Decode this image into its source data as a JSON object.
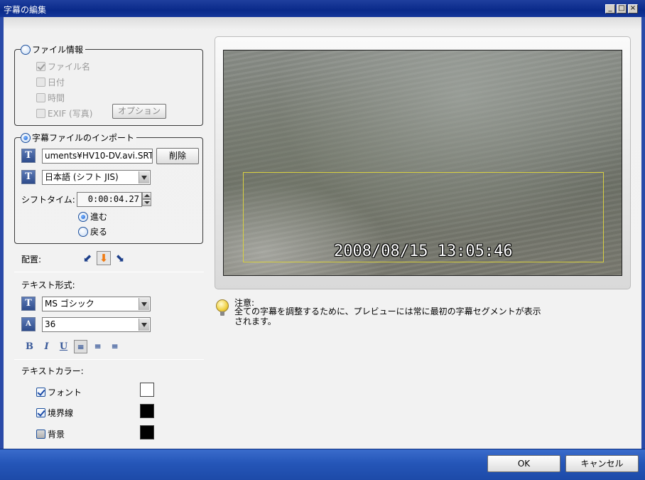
{
  "window": {
    "title": "字幕の編集"
  },
  "file_info": {
    "legend": "ファイル情報",
    "filename_label": "ファイル名",
    "date_label": "日付",
    "time_label": "時間",
    "exif_label": "EXIF (写真)",
    "option_button": "オプション"
  },
  "import": {
    "legend": "字幕ファイルのインポート",
    "path_value": "uments¥HV10-DV.avi.SRT",
    "delete_button": "削除",
    "encoding_value": "日本語 (シフト JIS)",
    "shift_time_label": "シフトタイム:",
    "shift_time_value": "0:00:04.27",
    "forward_label": "進む",
    "back_label": "戻る"
  },
  "placement": {
    "label": "配置:"
  },
  "text_format": {
    "label": "テキスト形式:",
    "font_value": "MS ゴシック",
    "size_value": "36",
    "bold": "B",
    "italic": "I",
    "underline": "U"
  },
  "text_color": {
    "label": "テキストカラー:",
    "font_label": "フォント",
    "border_label": "境界線",
    "background_label": "背景",
    "font_color": "#ffffff",
    "border_color": "#000000",
    "background_color": "#000000"
  },
  "preview": {
    "timestamp": "2008/08/15 13:05:46"
  },
  "note": {
    "title": "注意:",
    "body": "全ての字幕を調整するために、プレビューには常に最初の字幕セグメントが表示されます。"
  },
  "footer": {
    "ok_button": "OK",
    "cancel_button": "キャンセル"
  }
}
